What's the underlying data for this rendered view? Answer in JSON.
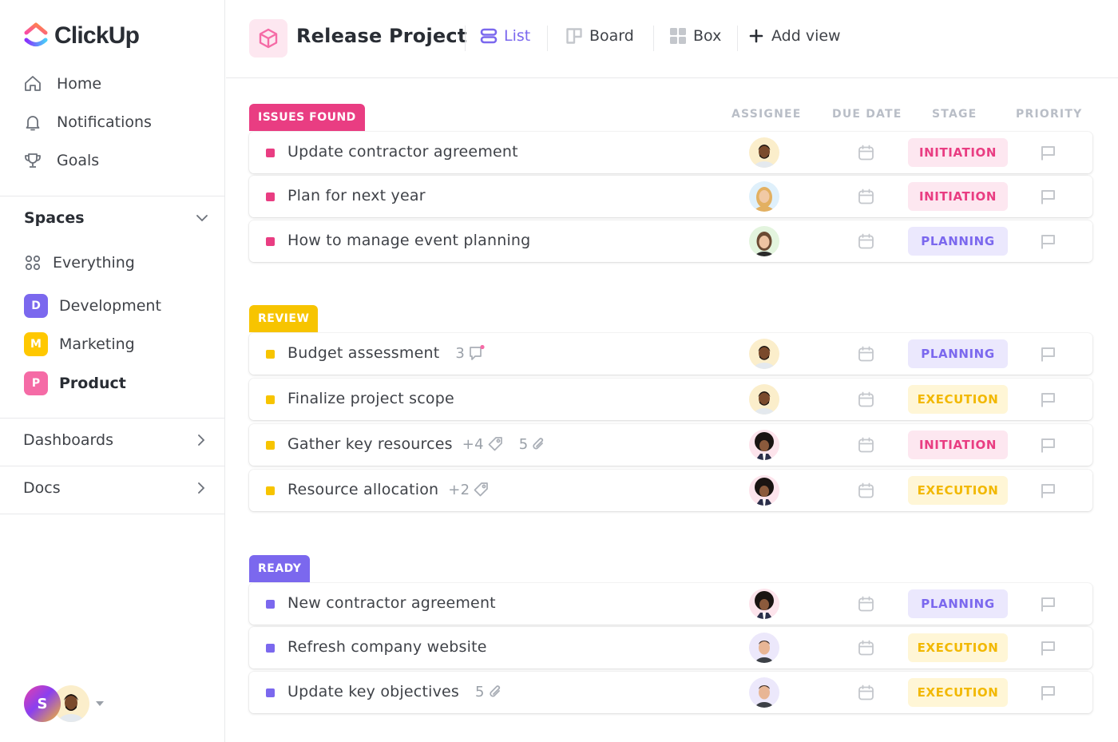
{
  "colors": {
    "accent": "#7b68ee",
    "issues": "#e93d82",
    "review": "#f7c400",
    "ready": "#7b68ee",
    "stage_initiation_bg": "#fde7f0",
    "stage_initiation_fg": "#e93d82",
    "stage_planning_bg": "#ebe8fd",
    "stage_planning_fg": "#7b68ee",
    "stage_execution_bg": "#fff6d6",
    "stage_execution_fg": "#f2b800"
  },
  "sidebar": {
    "logo_text": "ClickUp",
    "nav": [
      {
        "label": "Home",
        "icon": "home-icon"
      },
      {
        "label": "Notifications",
        "icon": "bell-icon"
      },
      {
        "label": "Goals",
        "icon": "trophy-icon"
      }
    ],
    "spaces_title": "Spaces",
    "everything_label": "Everything",
    "spaces": [
      {
        "initial": "D",
        "label": "Development",
        "color": "#7b68ee"
      },
      {
        "initial": "M",
        "label": "Marketing",
        "color": "#ffc800"
      },
      {
        "initial": "P",
        "label": "Product",
        "color": "#f56ba6"
      }
    ],
    "dashboards_label": "Dashboards",
    "docs_label": "Docs",
    "user_initial": "S"
  },
  "header": {
    "title": "Release Project",
    "views": [
      {
        "label": "List",
        "icon": "list-icon",
        "active": true
      },
      {
        "label": "Board",
        "icon": "board-icon"
      },
      {
        "label": "Box",
        "icon": "box-icon"
      }
    ],
    "add_view_label": "Add view"
  },
  "columns": {
    "assignee": "ASSIGNEE",
    "due_date": "DUE DATE",
    "stage": "STAGE",
    "priority": "PRIORITY"
  },
  "groups": [
    {
      "label": "ISSUES FOUND",
      "tasks": [
        {
          "name": "Update contractor agreement",
          "assignee": "man-beard",
          "stage": "INITIATION"
        },
        {
          "name": "Plan for next year",
          "assignee": "woman-blonde",
          "stage": "INITIATION"
        },
        {
          "name": "How to manage event planning",
          "assignee": "woman-brunette",
          "stage": "PLANNING"
        }
      ]
    },
    {
      "label": "REVIEW",
      "tasks": [
        {
          "name": "Budget assessment",
          "comments": "3",
          "assignee": "man-beard",
          "stage": "PLANNING"
        },
        {
          "name": "Finalize project scope",
          "assignee": "man-beard",
          "stage": "EXECUTION"
        },
        {
          "name": "Gather key resources",
          "tags": "+4",
          "attachments": "5",
          "assignee": "man-afro",
          "stage": "INITIATION"
        },
        {
          "name": "Resource allocation",
          "tags": "+2",
          "assignee": "man-afro",
          "stage": "EXECUTION"
        }
      ]
    },
    {
      "label": "READY",
      "tasks": [
        {
          "name": "New contractor agreement",
          "assignee": "man-afro",
          "stage": "PLANNING"
        },
        {
          "name": "Refresh company website",
          "assignee": "man-smile",
          "stage": "EXECUTION"
        },
        {
          "name": "Update key objectives",
          "attachments": "5",
          "assignee": "man-smile",
          "stage": "EXECUTION"
        }
      ]
    }
  ]
}
